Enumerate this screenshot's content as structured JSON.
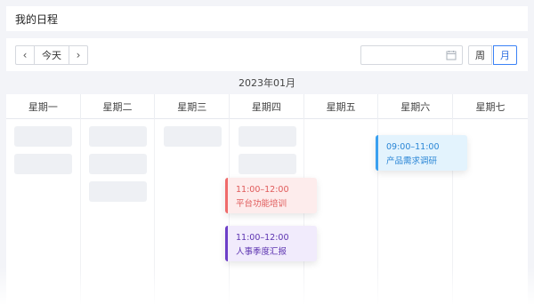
{
  "header": {
    "title": "我的日程"
  },
  "toolbar": {
    "prev_icon": "‹",
    "today_label": "今天",
    "next_icon": "›",
    "date_placeholder": "",
    "view_week_label": "周",
    "view_month_label": "月",
    "active_view": "月"
  },
  "calendar": {
    "month_label": "2023年01月",
    "weekdays": [
      "星期一",
      "星期二",
      "星期三",
      "星期四",
      "星期五",
      "星期六",
      "星期七"
    ]
  },
  "events": [
    {
      "time": "09:00–11:00",
      "title": "产品需求调研",
      "color": "#3aa0f0",
      "day": "星期六"
    },
    {
      "time": "11:00–12:00",
      "title": "平台功能培训",
      "color": "#ef6b6b",
      "day": "星期四"
    },
    {
      "time": "11:00–12:00",
      "title": "人事季度汇报",
      "color": "#6d3fc8",
      "day": "星期四"
    }
  ],
  "colors": {
    "accent": "#3b82f6",
    "background": "#f3f4f8",
    "placeholder": "#eef0f4"
  }
}
